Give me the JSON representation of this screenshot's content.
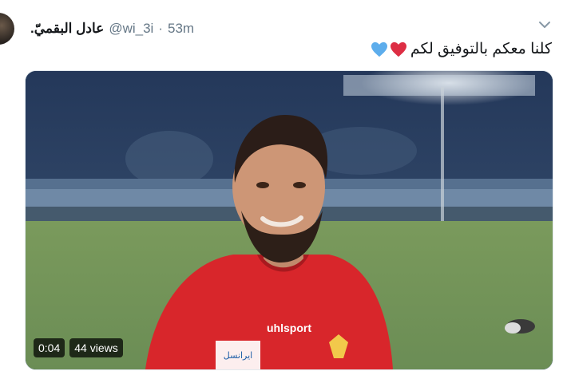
{
  "tweet": {
    "author_name": "عادل البقميّ.",
    "handle": "@wi_3i",
    "separator": "·",
    "time": "53m",
    "text": "كلنا معكم بالتوفيق لكم",
    "hearts": [
      {
        "icon": "blue-heart-icon",
        "color": "#5dadec"
      },
      {
        "icon": "red-heart-icon",
        "color": "#dd2e44"
      }
    ]
  },
  "video": {
    "duration": "0:04",
    "views": "44 views",
    "shirt_brand": "uhlsport",
    "sponsor": "ایرانسل"
  }
}
